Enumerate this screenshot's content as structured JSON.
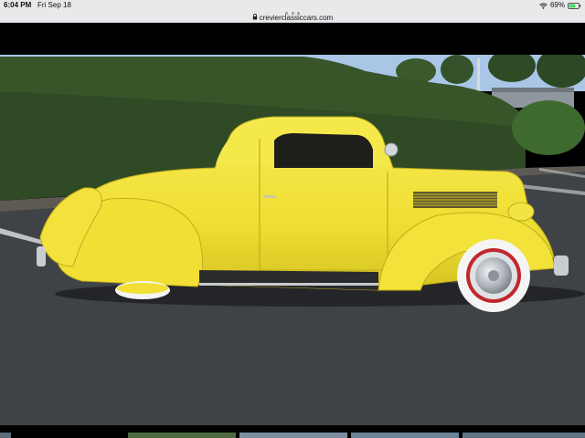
{
  "status_bar": {
    "time": "6:04 PM",
    "date": "Fri Sep 18",
    "battery_percent": "69%",
    "battery_level": 0.69,
    "icons": [
      "wifi-icon",
      "battery-icon"
    ]
  },
  "browser": {
    "url": "crevierclassiccars.com",
    "icons": [
      "lock-icon",
      "tab-dots-icon"
    ]
  },
  "photo": {
    "subject": "yellow-coupe-car"
  },
  "colors": {
    "car_body": "#f2e23a",
    "car_shadow": "#c9b81e",
    "asphalt": "#3f4246",
    "hedge": "#2f4a24",
    "sky": "#a9c6e6",
    "chrome": "#c9ccd0",
    "tire": "#1c1c1c",
    "whitewall": "#f4f4f4",
    "wheel_red": "#c1272d"
  },
  "thumbnails": {
    "count": 5
  }
}
